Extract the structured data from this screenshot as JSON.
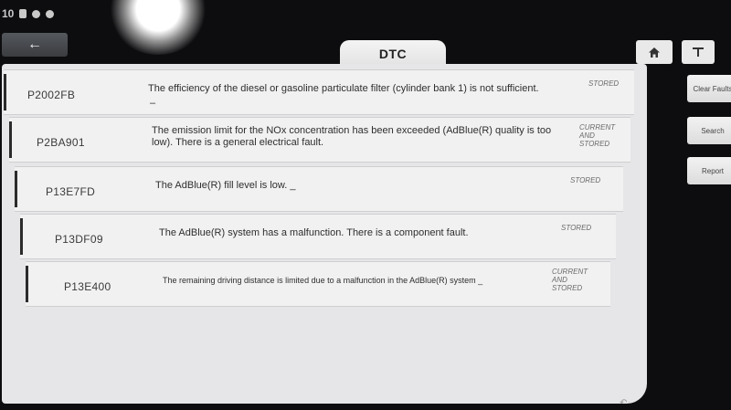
{
  "status_bar": {
    "time": "10"
  },
  "header": {
    "back_label": "←",
    "tab_title": "DTC",
    "home_icon": "home-icon",
    "tool_icon": "tool-icon"
  },
  "dtcs": [
    {
      "code": "P2002FB",
      "description": "The efficiency of the diesel or gasoline particulate filter (cylinder bank 1) is not sufficient.",
      "extra": "–",
      "status": "STORED"
    },
    {
      "code": "P2BA901",
      "description": "The emission limit for the NOx concentration has been exceeded (AdBlue(R) quality is too low). There is a general electrical fault.",
      "extra": "",
      "status": "CURRENT And STORED"
    },
    {
      "code": "P13E7FD",
      "description": "The AdBlue(R) fill level is low. _",
      "extra": "",
      "status": "STORED"
    },
    {
      "code": "P13DF09",
      "description": "The AdBlue(R) system has a malfunction. There is a component fault.",
      "extra": "",
      "status": "STORED"
    },
    {
      "code": "P13E400",
      "description": "The remaining driving distance is limited due to a malfunction in the AdBlue(R) system _",
      "extra": "",
      "status": "CURRENT And STORED"
    }
  ],
  "side_buttons": {
    "clear": "Clear Faults",
    "search": "Search",
    "report": "Report"
  },
  "colors": {
    "panel": "#e6e6e8",
    "row": "#f1f1f2",
    "bezel": "#0d0d0f"
  }
}
